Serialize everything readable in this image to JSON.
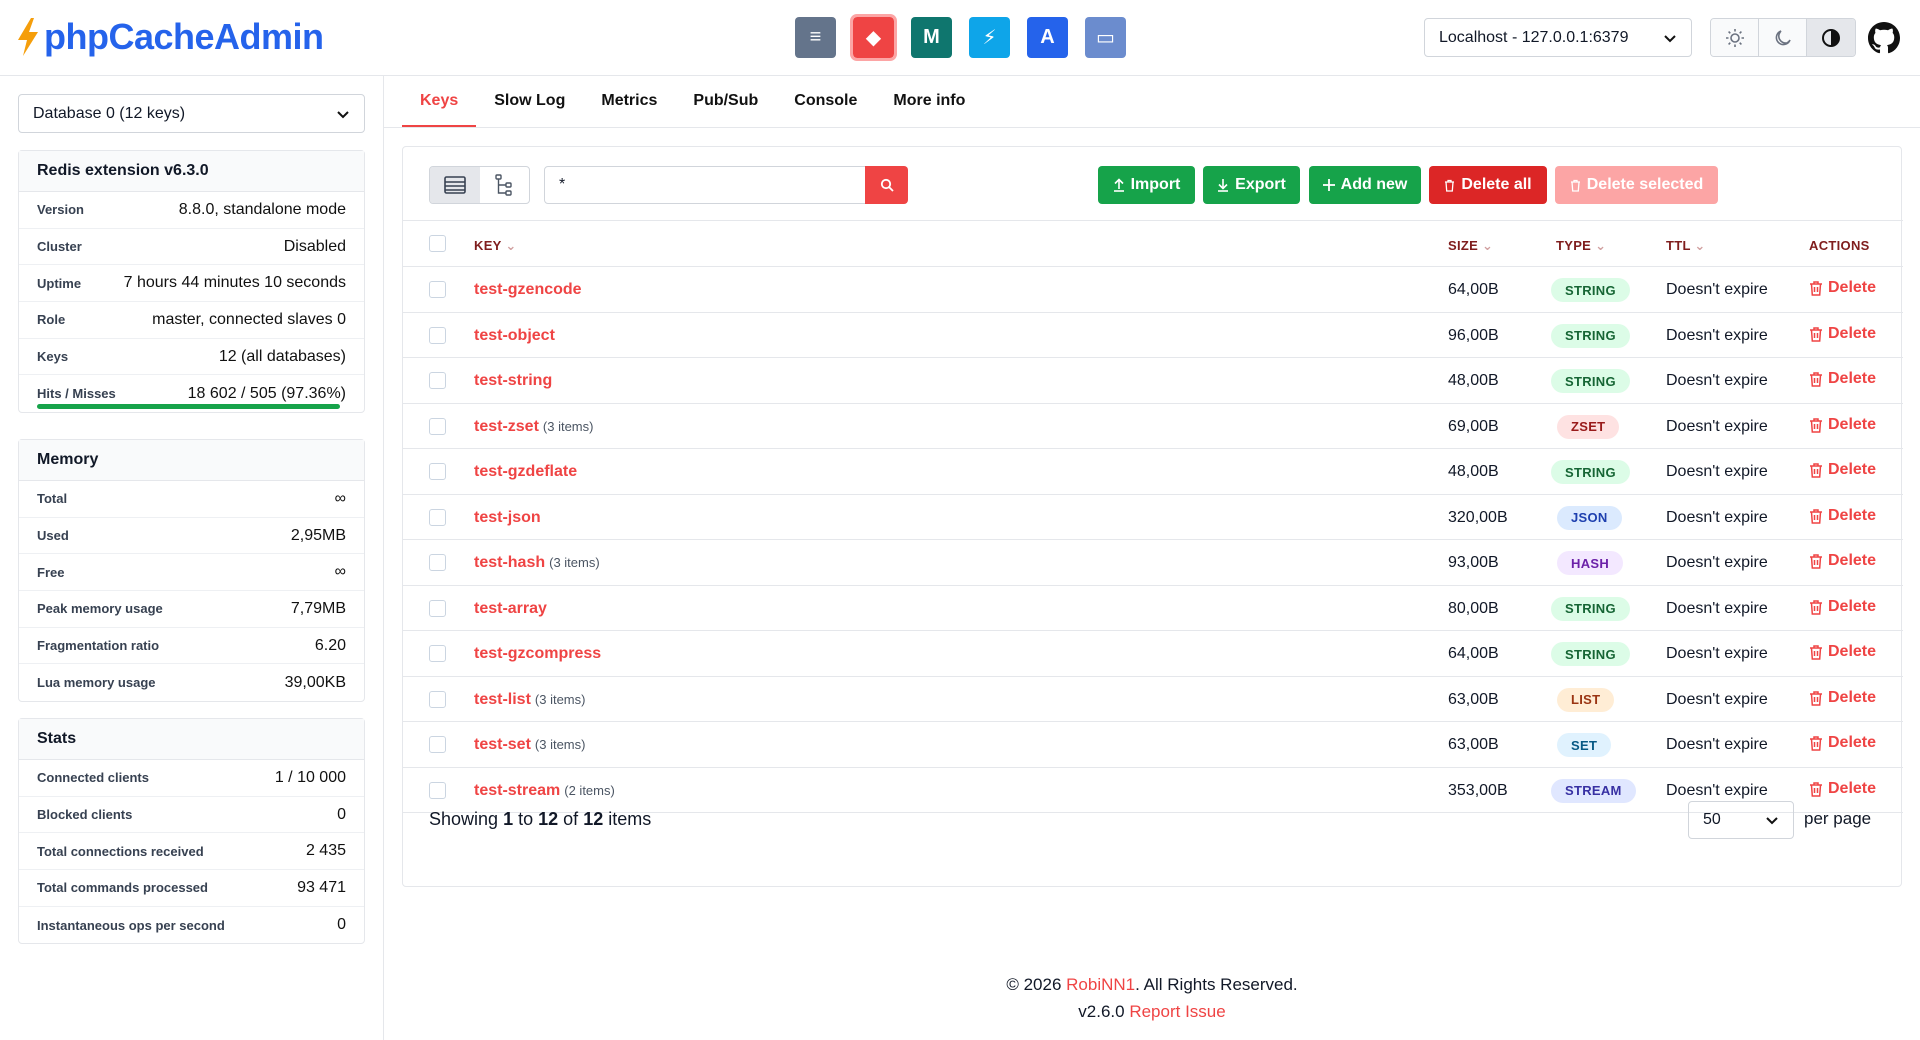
{
  "app": {
    "name": "phpCacheAdmin",
    "brand_color": "#2563eb",
    "accent": "#ef4444"
  },
  "dashboards": [
    {
      "icon": "server-icon",
      "color": "#64748b",
      "glyph": "≡"
    },
    {
      "icon": "redis-icon",
      "color": "#ef4444",
      "glyph": "◆"
    },
    {
      "icon": "memcached-icon",
      "color": "#0f766e",
      "glyph": "M"
    },
    {
      "icon": "opcache-icon",
      "color": "#0ea5e9",
      "glyph": "⚡"
    },
    {
      "icon": "apcu-icon",
      "color": "#2563eb",
      "glyph": "A"
    },
    {
      "icon": "folder-icon",
      "color": "#6b8cce",
      "glyph": "▭"
    }
  ],
  "server_select": {
    "value": "Localhost - 127.0.0.1:6379"
  },
  "sidebar": {
    "db_select": "Database 0 (12 keys)",
    "info": {
      "title": "Redis extension v6.3.0",
      "rows": [
        {
          "label": "Version",
          "value": "8.8.0, standalone mode"
        },
        {
          "label": "Cluster",
          "value": "Disabled"
        },
        {
          "label": "Uptime",
          "value": "7 hours 44 minutes 10 seconds"
        },
        {
          "label": "Role",
          "value": "master, connected slaves 0"
        },
        {
          "label": "Keys",
          "value": "12 (all databases)"
        },
        {
          "label": "Hits / Misses",
          "value": "18 602 / 505 (97.36%)"
        }
      ],
      "hit_ratio": 0.9736
    },
    "memory": {
      "title": "Memory",
      "rows": [
        {
          "label": "Total",
          "value": "∞"
        },
        {
          "label": "Used",
          "value": "2,95MB"
        },
        {
          "label": "Free",
          "value": "∞"
        },
        {
          "label": "Peak memory usage",
          "value": "7,79MB"
        },
        {
          "label": "Fragmentation ratio",
          "value": "6.20"
        },
        {
          "label": "Lua memory usage",
          "value": "39,00KB"
        }
      ]
    },
    "stats": {
      "title": "Stats",
      "rows": [
        {
          "label": "Connected clients",
          "value": "1 / 10 000"
        },
        {
          "label": "Blocked clients",
          "value": "0"
        },
        {
          "label": "Total connections received",
          "value": "2 435"
        },
        {
          "label": "Total commands processed",
          "value": "93 471"
        },
        {
          "label": "Instantaneous ops per second",
          "value": "0"
        }
      ]
    }
  },
  "tabs": [
    "Keys",
    "Slow Log",
    "Metrics",
    "Pub/Sub",
    "Console",
    "More info"
  ],
  "toolbar": {
    "search_value": "*",
    "import": "Import",
    "export": "Export",
    "add_new": "Add new",
    "delete_all": "Delete all",
    "delete_selected": "Delete selected"
  },
  "table": {
    "headers": {
      "key": "KEY",
      "size": "SIZE",
      "type": "TYPE",
      "ttl": "TTL",
      "actions": "ACTIONS"
    },
    "rows": [
      {
        "key": "test-gzencode",
        "count": "",
        "size": "64,00B",
        "type": "STRING",
        "ttl": "Doesn't expire",
        "action": "Delete"
      },
      {
        "key": "test-object",
        "count": "",
        "size": "96,00B",
        "type": "STRING",
        "ttl": "Doesn't expire",
        "action": "Delete"
      },
      {
        "key": "test-string",
        "count": "",
        "size": "48,00B",
        "type": "STRING",
        "ttl": "Doesn't expire",
        "action": "Delete"
      },
      {
        "key": "test-zset",
        "count": "(3 items)",
        "size": "69,00B",
        "type": "ZSET",
        "ttl": "Doesn't expire",
        "action": "Delete"
      },
      {
        "key": "test-gzdeflate",
        "count": "",
        "size": "48,00B",
        "type": "STRING",
        "ttl": "Doesn't expire",
        "action": "Delete"
      },
      {
        "key": "test-json",
        "count": "",
        "size": "320,00B",
        "type": "JSON",
        "ttl": "Doesn't expire",
        "action": "Delete"
      },
      {
        "key": "test-hash",
        "count": "(3 items)",
        "size": "93,00B",
        "type": "HASH",
        "ttl": "Doesn't expire",
        "action": "Delete"
      },
      {
        "key": "test-array",
        "count": "",
        "size": "80,00B",
        "type": "STRING",
        "ttl": "Doesn't expire",
        "action": "Delete"
      },
      {
        "key": "test-gzcompress",
        "count": "",
        "size": "64,00B",
        "type": "STRING",
        "ttl": "Doesn't expire",
        "action": "Delete"
      },
      {
        "key": "test-list",
        "count": "(3 items)",
        "size": "63,00B",
        "type": "LIST",
        "ttl": "Doesn't expire",
        "action": "Delete"
      },
      {
        "key": "test-set",
        "count": "(3 items)",
        "size": "63,00B",
        "type": "SET",
        "ttl": "Doesn't expire",
        "action": "Delete"
      },
      {
        "key": "test-stream",
        "count": "(2 items)",
        "size": "353,00B",
        "type": "STREAM",
        "ttl": "Doesn't expire",
        "action": "Delete"
      }
    ]
  },
  "badge_colors": {
    "STRING": {
      "bg": "#dcfce7",
      "fg": "#166534"
    },
    "ZSET": {
      "bg": "#fee2e2",
      "fg": "#991b1b"
    },
    "JSON": {
      "bg": "#dbeafe",
      "fg": "#1e40af"
    },
    "HASH": {
      "bg": "#f3e8ff",
      "fg": "#6b21a8"
    },
    "LIST": {
      "bg": "#ffedd5",
      "fg": "#9a3412"
    },
    "SET": {
      "bg": "#e0f2fe",
      "fg": "#075985"
    },
    "STREAM": {
      "bg": "#e0e7ff",
      "fg": "#3730a3"
    }
  },
  "pagination": {
    "prefix": "Showing",
    "from": "1",
    "to_word": "to",
    "to": "12",
    "of_word": "of",
    "total": "12",
    "suffix": "items",
    "per_page_value": "50",
    "per_page_label": "per page"
  },
  "footer": {
    "copyright_prefix": "© 2026",
    "author": "RobiNN1",
    "copyright_suffix": ". All Rights Reserved.",
    "version": "v2.6.0",
    "report": "Report Issue"
  }
}
